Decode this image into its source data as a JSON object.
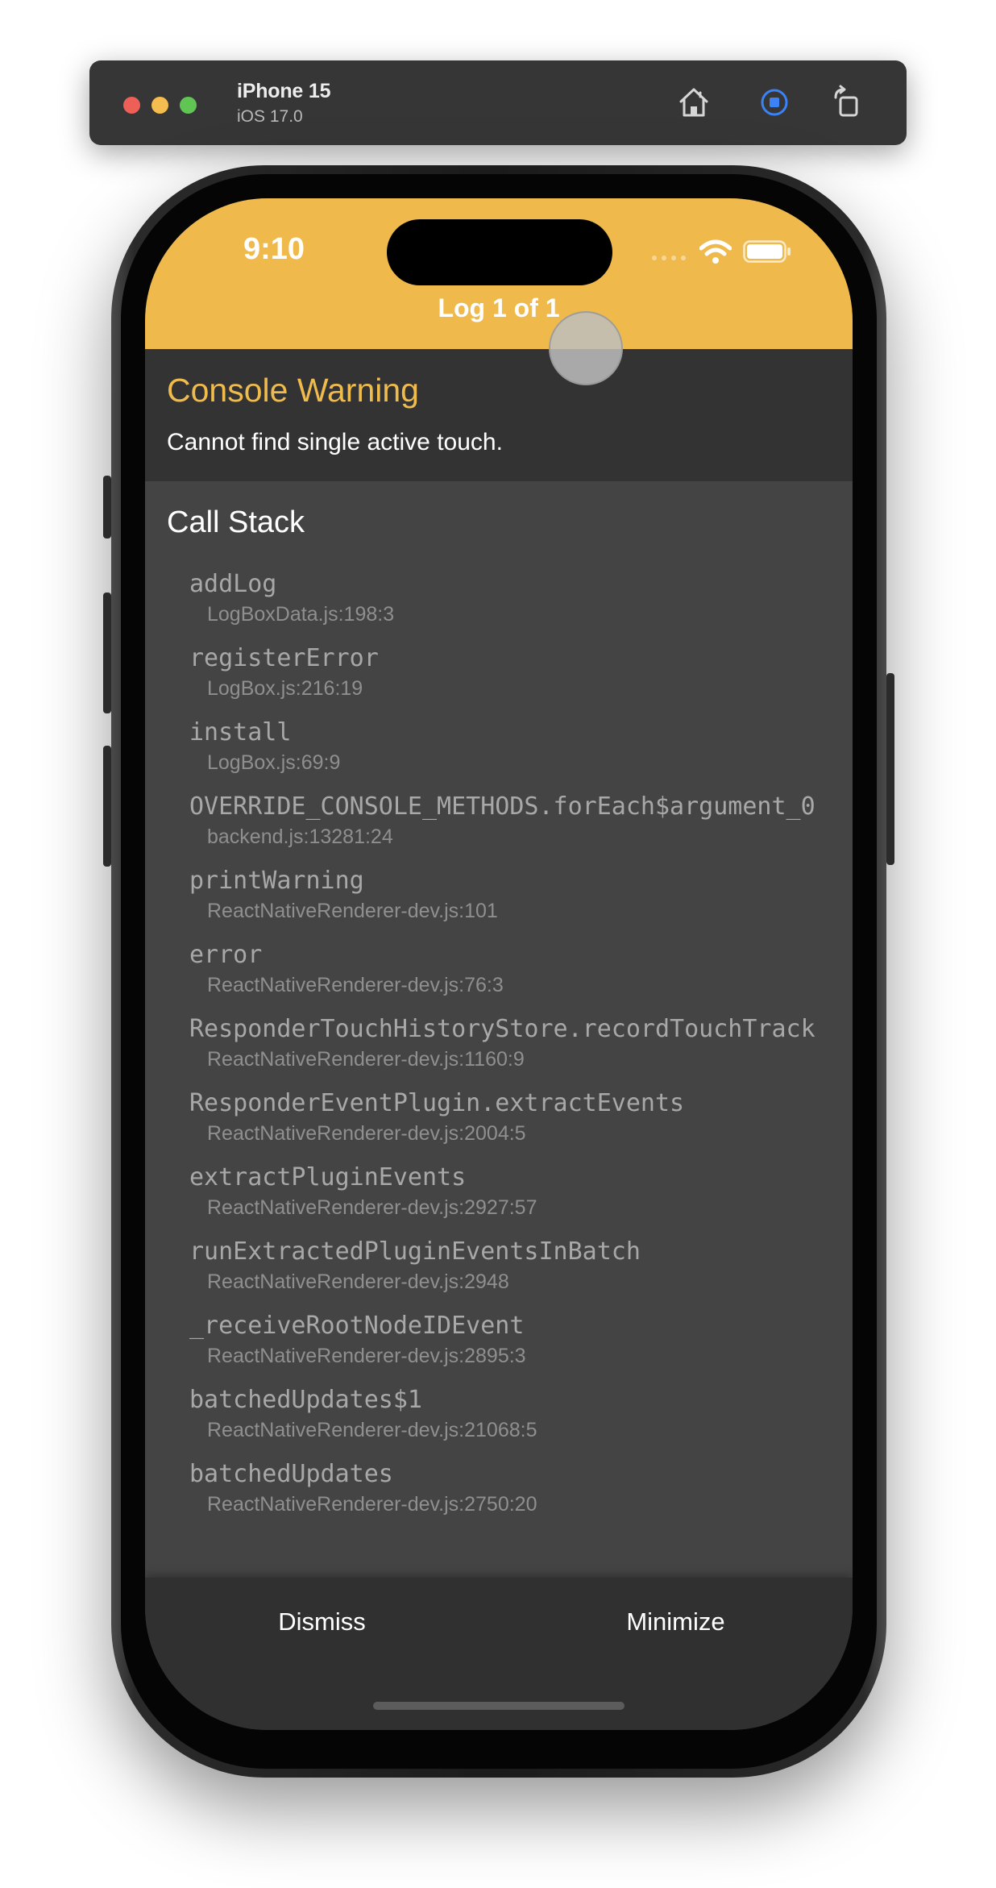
{
  "simulator": {
    "device_name": "iPhone 15",
    "os_version": "iOS 17.0",
    "icons": [
      "home-icon",
      "screenshot-icon",
      "rotate-icon"
    ]
  },
  "status_bar": {
    "time": "9:10",
    "icons": [
      "signal-icon",
      "wifi-icon",
      "battery-icon"
    ]
  },
  "header": {
    "title": "Log 1 of 1",
    "color": "#efba4b"
  },
  "warning": {
    "title": "Console Warning",
    "message": "Cannot find single active touch.",
    "color": "#f0bb4d"
  },
  "call_stack": {
    "title": "Call Stack",
    "frames": [
      {
        "fn": "addLog",
        "loc": "LogBoxData.js:198:3"
      },
      {
        "fn": "registerError",
        "loc": "LogBox.js:216:19"
      },
      {
        "fn": "install",
        "loc": "LogBox.js:69:9"
      },
      {
        "fn": "OVERRIDE_CONSOLE_METHODS.forEach$argument_0",
        "loc": "backend.js:13281:24"
      },
      {
        "fn": "printWarning",
        "loc": "ReactNativeRenderer-dev.js:101"
      },
      {
        "fn": "error",
        "loc": "ReactNativeRenderer-dev.js:76:3"
      },
      {
        "fn": "ResponderTouchHistoryStore.recordTouchTrack",
        "loc": "ReactNativeRenderer-dev.js:1160:9"
      },
      {
        "fn": "ResponderEventPlugin.extractEvents",
        "loc": "ReactNativeRenderer-dev.js:2004:5"
      },
      {
        "fn": "extractPluginEvents",
        "loc": "ReactNativeRenderer-dev.js:2927:57"
      },
      {
        "fn": "runExtractedPluginEventsInBatch",
        "loc": "ReactNativeRenderer-dev.js:2948"
      },
      {
        "fn": "_receiveRootNodeIDEvent",
        "loc": "ReactNativeRenderer-dev.js:2895:3"
      },
      {
        "fn": "batchedUpdates$1",
        "loc": "ReactNativeRenderer-dev.js:21068:5"
      },
      {
        "fn": "batchedUpdates",
        "loc": "ReactNativeRenderer-dev.js:2750:20"
      }
    ]
  },
  "footer": {
    "dismiss_label": "Dismiss",
    "minimize_label": "Minimize"
  }
}
